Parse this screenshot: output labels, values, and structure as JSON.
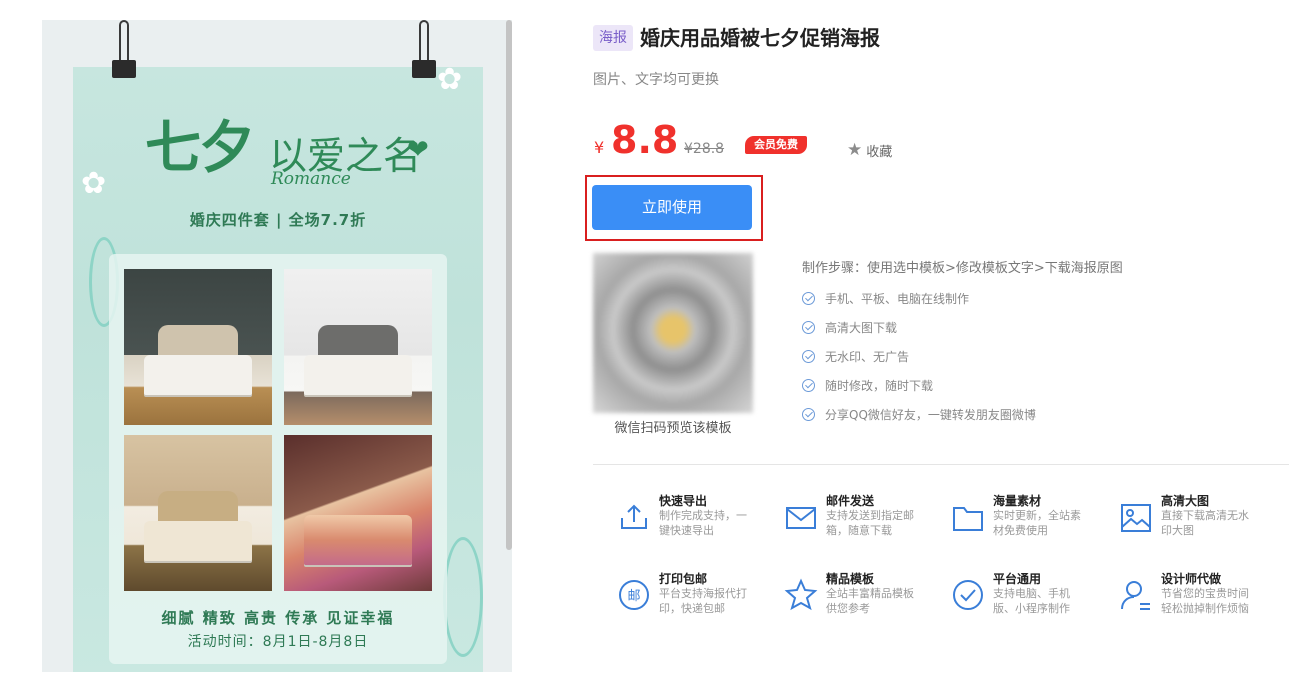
{
  "poster": {
    "title_cn_main": "七夕",
    "title_cn_rest": "以爱之名",
    "title_en": "Romance",
    "subtitle": "婚庆四件套 | 全场7.7折",
    "footer_line1": "细腻 精致 高贵 传承 见证幸福",
    "footer_line2": "活动时间：8月1日-8月8日"
  },
  "product": {
    "tag": "海报",
    "title": "婚庆用品婚被七夕促销海报",
    "subtitle": "图片、文字均可更换",
    "currency": "¥",
    "price": "8.8",
    "old_price": "¥28.8",
    "vip_badge": "会员免费",
    "favorite_label": "收藏",
    "use_button": "立即使用"
  },
  "qr": {
    "label": "微信扫码预览该模板"
  },
  "steps": {
    "title": "制作步骤：使用选中模板>修改模板文字>下载海报原图",
    "features": [
      "手机、平板、电脑在线制作",
      "高清大图下载",
      "无水印、无广告",
      "随时修改，随时下载",
      "分享QQ微信好友，一键转发朋友圈微博"
    ]
  },
  "services": [
    {
      "icon": "export-icon",
      "name": "快速导出",
      "desc": "制作完成支持，一键快速导出"
    },
    {
      "icon": "mail-icon",
      "name": "邮件发送",
      "desc": "支持发送到指定邮箱，随意下载"
    },
    {
      "icon": "folder-icon",
      "name": "海量素材",
      "desc": "实时更新，全站素材免费使用"
    },
    {
      "icon": "image-icon",
      "name": "高清大图",
      "desc": "直接下载高清无水印大图"
    },
    {
      "icon": "post-icon",
      "name": "打印包邮",
      "desc": "平台支持海报代打印，快递包邮"
    },
    {
      "icon": "star-icon",
      "name": "精品模板",
      "desc": "全站丰富精品模板供您参考"
    },
    {
      "icon": "check-circle-icon",
      "name": "平台通用",
      "desc": "支持电脑、手机版、小程序制作"
    },
    {
      "icon": "designer-icon",
      "name": "设计师代做",
      "desc": "节省您的宝贵时间轻松抛掉制作烦恼"
    }
  ],
  "colors": {
    "accent": "#3a8ef6",
    "price": "#f0312c",
    "poster_green": "#2f8a58",
    "highlight_frame": "#d91f1f"
  }
}
